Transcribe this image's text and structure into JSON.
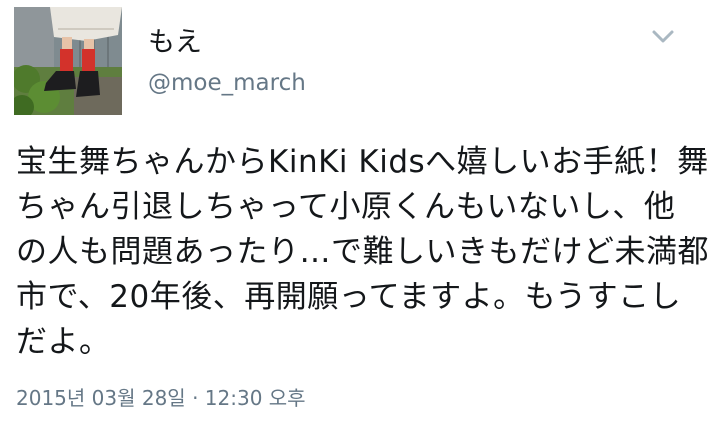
{
  "user": {
    "display_name": "もえ",
    "handle": "@moe_march"
  },
  "icons": {
    "avatar": "avatar-photo-red-socks-boots",
    "menu": "chevron-down-icon"
  },
  "tweet": {
    "lines": [
      "宝生舞ちゃんからKinKi Kidsへ嬉しいお手紙！舞",
      "ちゃん引退しちゃって小原くんもいないし、他",
      "の人も問題あったり…で難しいきもだけど未満都",
      "市で、20年後、再開願ってますよ。もうすこし",
      "だよ。"
    ],
    "timestamp": "2015년 03월 28일 · 12:30 오후"
  },
  "colors": {
    "text": "#14171a",
    "secondary": "#657786",
    "caret": "#aab8c2"
  }
}
